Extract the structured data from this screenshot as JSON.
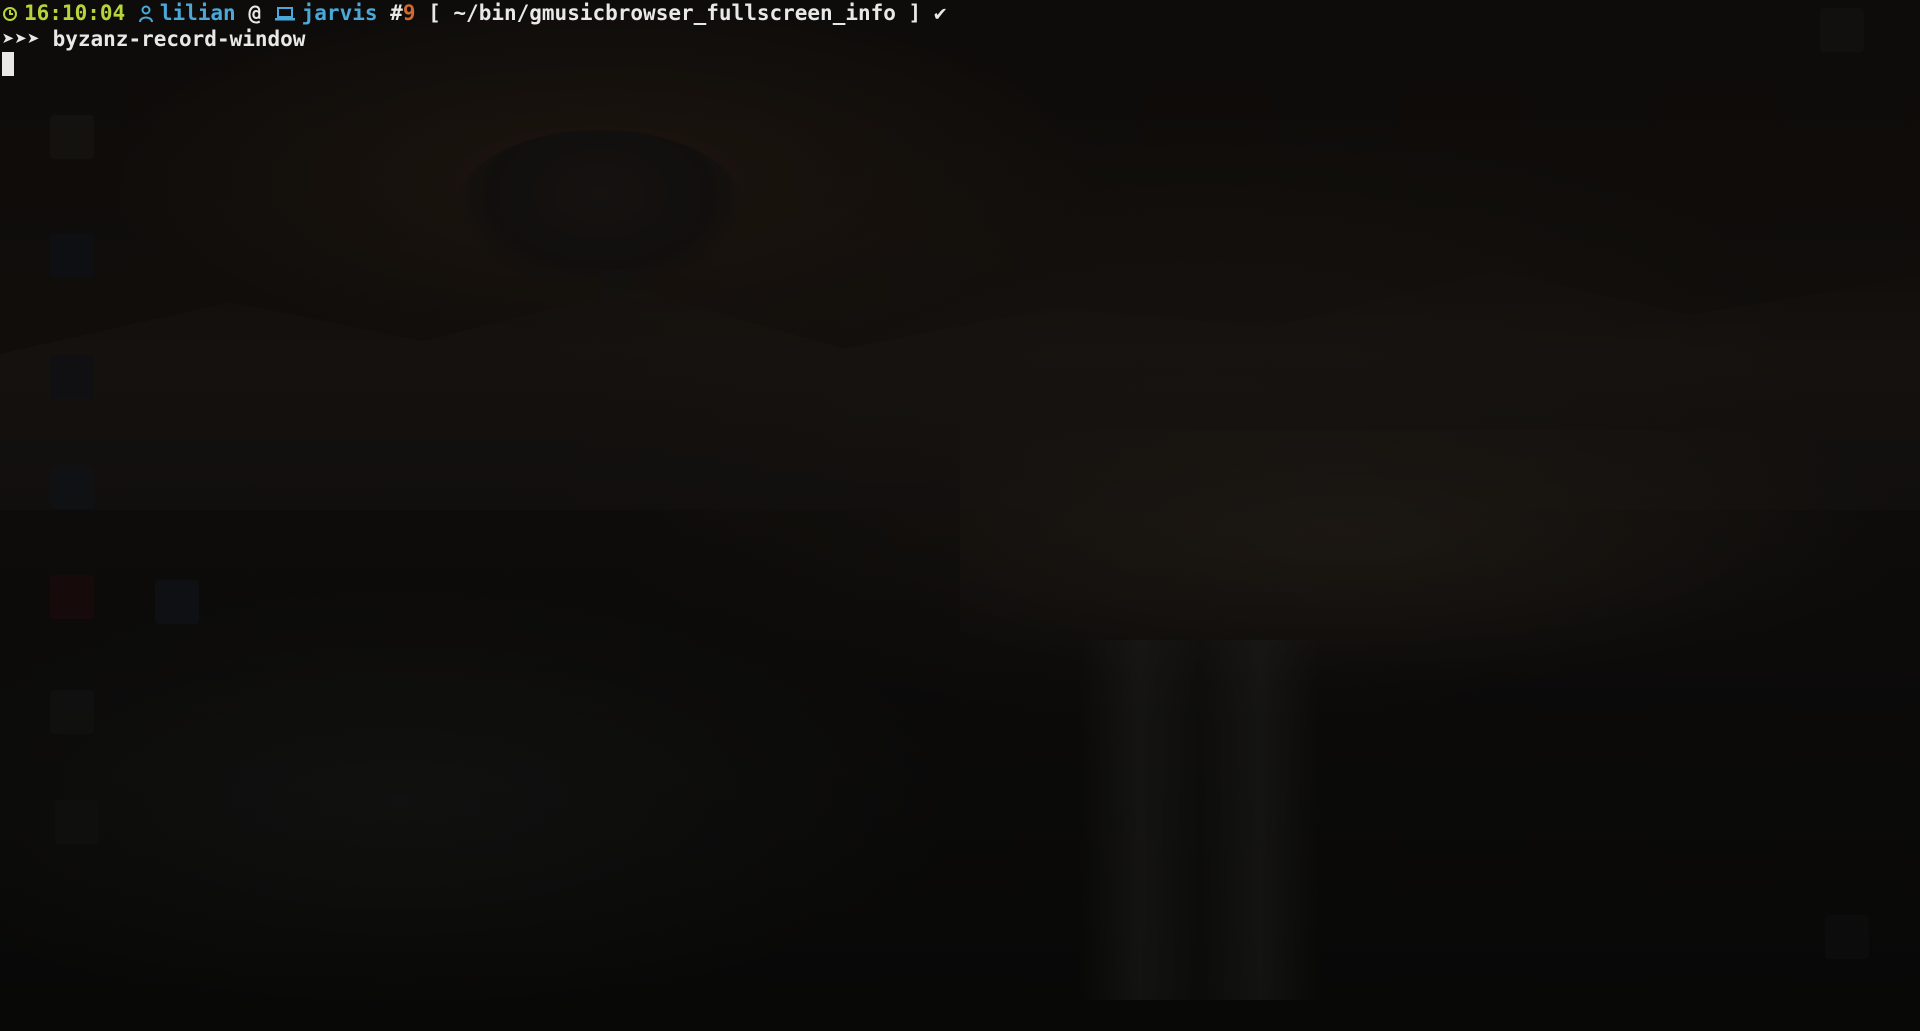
{
  "prompt": {
    "time": "16:10:04",
    "user": "lilian",
    "at": "@",
    "host": "jarvis",
    "hash": "#",
    "number": "9",
    "path": "[ ~/bin/gmusicbrowser_fullscreen_info ]",
    "status": "✔"
  },
  "command": {
    "prefix": "➤➤➤",
    "text": "byzanz-record-window"
  },
  "colors": {
    "time": "#b7d43a",
    "user": "#4aa9d8",
    "number": "#d06a2e",
    "text": "#e8e8e8",
    "background": "#0b0a09"
  },
  "icons": [
    "clock-icon",
    "user-icon",
    "laptop-icon"
  ]
}
